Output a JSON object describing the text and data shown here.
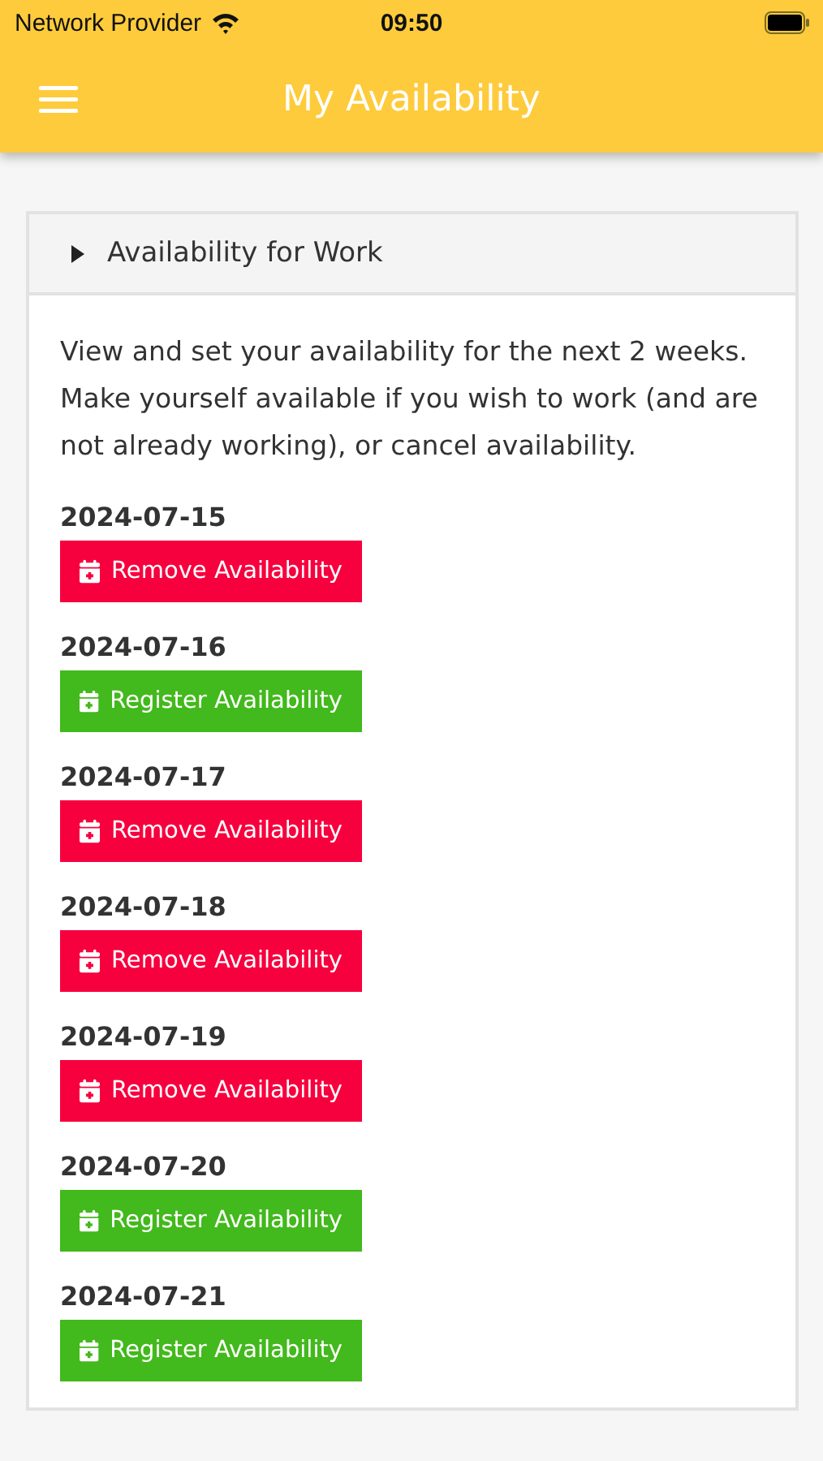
{
  "status_bar": {
    "carrier": "Network Provider",
    "time": "09:50"
  },
  "header": {
    "title": "My Availability"
  },
  "panel": {
    "title": "Availability for Work",
    "expanded": false,
    "description": "View and set your availability for the next 2 weeks. Make yourself available if you wish to work (and are not already working), or cancel availability."
  },
  "days": [
    {
      "date": "2024-07-15",
      "kind": "remove",
      "button": "Remove Availability"
    },
    {
      "date": "2024-07-16",
      "kind": "register",
      "button": "Register Availability"
    },
    {
      "date": "2024-07-17",
      "kind": "remove",
      "button": "Remove Availability"
    },
    {
      "date": "2024-07-18",
      "kind": "remove",
      "button": "Remove Availability"
    },
    {
      "date": "2024-07-19",
      "kind": "remove",
      "button": "Remove Availability"
    },
    {
      "date": "2024-07-20",
      "kind": "register",
      "button": "Register Availability"
    },
    {
      "date": "2024-07-21",
      "kind": "register",
      "button": "Register Availability"
    }
  ]
}
